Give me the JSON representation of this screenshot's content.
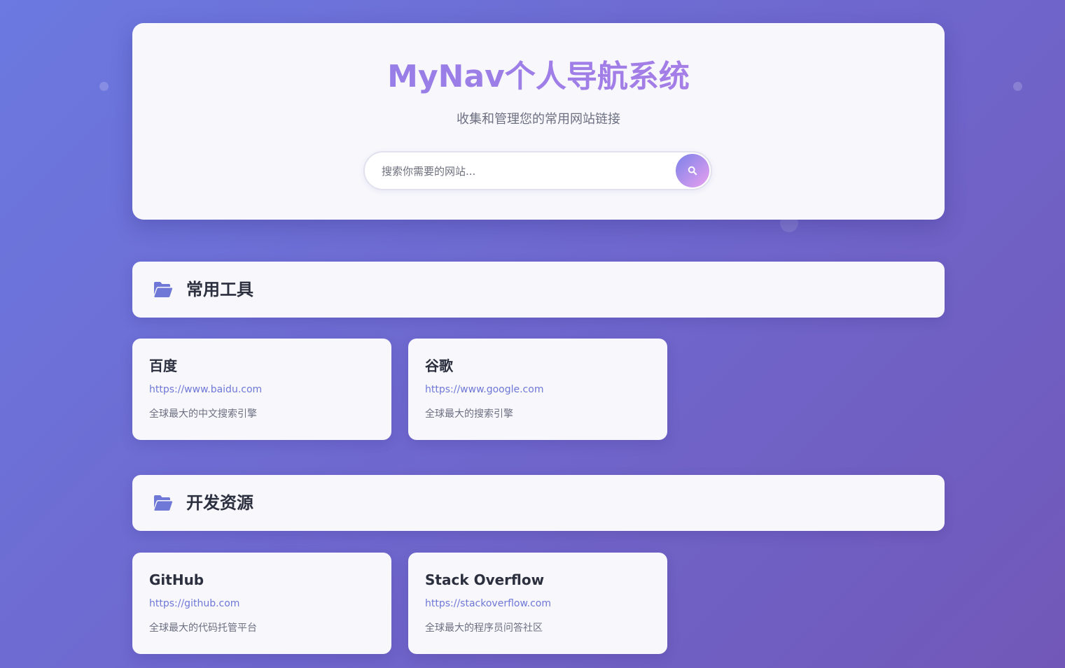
{
  "header": {
    "title": "MyNav个人导航系统",
    "subtitle": "收集和管理您的常用网站链接"
  },
  "search": {
    "placeholder": "搜索你需要的网站...",
    "button_icon": "search-icon"
  },
  "sections": [
    {
      "title": "常用工具",
      "icon": "folder-open-icon",
      "links": [
        {
          "title": "百度",
          "url": "https://www.baidu.com",
          "description": "全球最大的中文搜索引擎"
        },
        {
          "title": "谷歌",
          "url": "https://www.google.com",
          "description": "全球最大的搜索引擎"
        }
      ]
    },
    {
      "title": "开发资源",
      "icon": "folder-open-icon",
      "links": [
        {
          "title": "GitHub",
          "url": "https://github.com",
          "description": "全球最大的代码托管平台"
        },
        {
          "title": "Stack Overflow",
          "url": "https://stackoverflow.com",
          "description": "全球最大的程序员问答社区"
        }
      ]
    }
  ],
  "colors": {
    "accent": "#6f78d6",
    "title_gradient_start": "#8d7ee8",
    "title_gradient_end": "#b07ee6",
    "background_start": "#6b79e0",
    "background_end": "#7158b8"
  }
}
